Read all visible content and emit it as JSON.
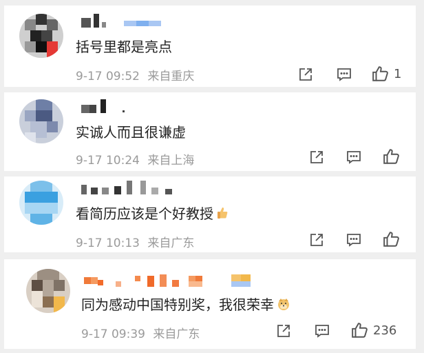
{
  "comments": [
    {
      "text": "括号里都是亮点",
      "date": "9-17 09:52",
      "location": "来自重庆",
      "likes": "1"
    },
    {
      "text": "实诚人而且很谦虚",
      "date": "9-17 10:24",
      "location": "来自上海",
      "likes": ""
    },
    {
      "text": "看简历应该是个好教授",
      "date": "9-17 10:13",
      "location": "来自广东",
      "likes": ""
    },
    {
      "text": "同为感动中国特别奖，我很荣幸",
      "date": "9-17 09:39",
      "location": "来自广东",
      "likes": "236"
    }
  ],
  "icons": {
    "share": "share-icon",
    "comment": "comment-icon",
    "like": "thumbs-up-icon"
  },
  "colors": {
    "meta_text": "#9a9a9a",
    "body_text": "#222222"
  }
}
